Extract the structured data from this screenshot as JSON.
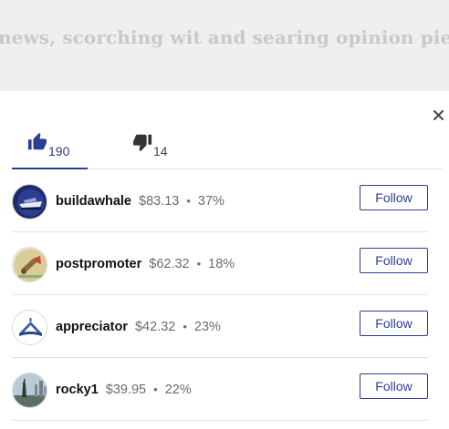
{
  "background": {
    "headline_fragment": "news, scorching wit and searing opinion pieces from Cr"
  },
  "modal": {
    "close_icon": "close-icon",
    "tabs": {
      "likes": {
        "icon": "thumbs-up-icon",
        "count": "190",
        "selected": true
      },
      "dislikes": {
        "icon": "thumbs-down-icon",
        "count": "14",
        "selected": false
      }
    },
    "users": [
      {
        "username": "buildawhale",
        "amount": "$83.13",
        "separator": "•",
        "percent": "37%",
        "button": "Follow",
        "avatar": "whale-boat-avatar"
      },
      {
        "username": "postpromoter",
        "amount": "$62.32",
        "separator": "•",
        "percent": "18%",
        "button": "Follow",
        "avatar": "megaphone-avatar"
      },
      {
        "username": "appreciator",
        "amount": "$42.32",
        "separator": "•",
        "percent": "23%",
        "button": "Follow",
        "avatar": "crown-logo-avatar"
      },
      {
        "username": "rocky1",
        "amount": "$39.95",
        "separator": "•",
        "percent": "22%",
        "button": "Follow",
        "avatar": "statue-skyline-avatar"
      }
    ]
  },
  "colors": {
    "accent": "#2c3e91",
    "text": "#111111",
    "muted": "#6c6c6c",
    "divider": "#e2e2e2",
    "backdrop": "#efefef"
  }
}
